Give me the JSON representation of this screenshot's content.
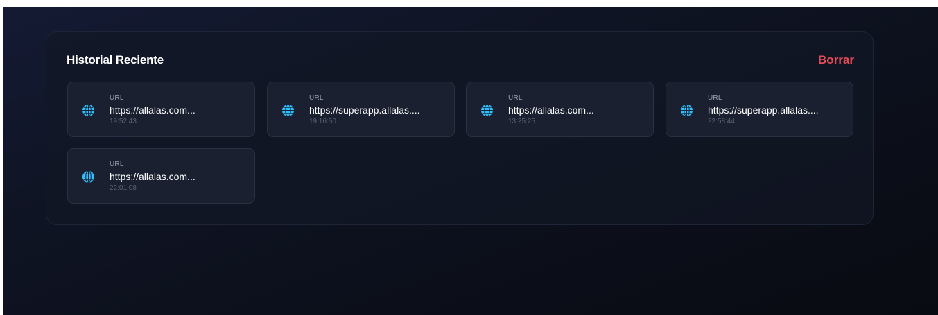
{
  "history": {
    "title": "Historial Reciente",
    "clear_label": "Borrar",
    "accent_color": "#e34a55",
    "icon": "globe-icon",
    "items": [
      {
        "type": "URL",
        "url": "https://allalas.com...",
        "time": "19:52:43"
      },
      {
        "type": "URL",
        "url": "https://superapp.allalas....",
        "time": "19:16:50"
      },
      {
        "type": "URL",
        "url": "https://allalas.com...",
        "time": "13:25:25"
      },
      {
        "type": "URL",
        "url": "https://superapp.allalas....",
        "time": "22:58:44"
      },
      {
        "type": "URL",
        "url": "https://allalas.com...",
        "time": "22:01:08"
      }
    ]
  }
}
